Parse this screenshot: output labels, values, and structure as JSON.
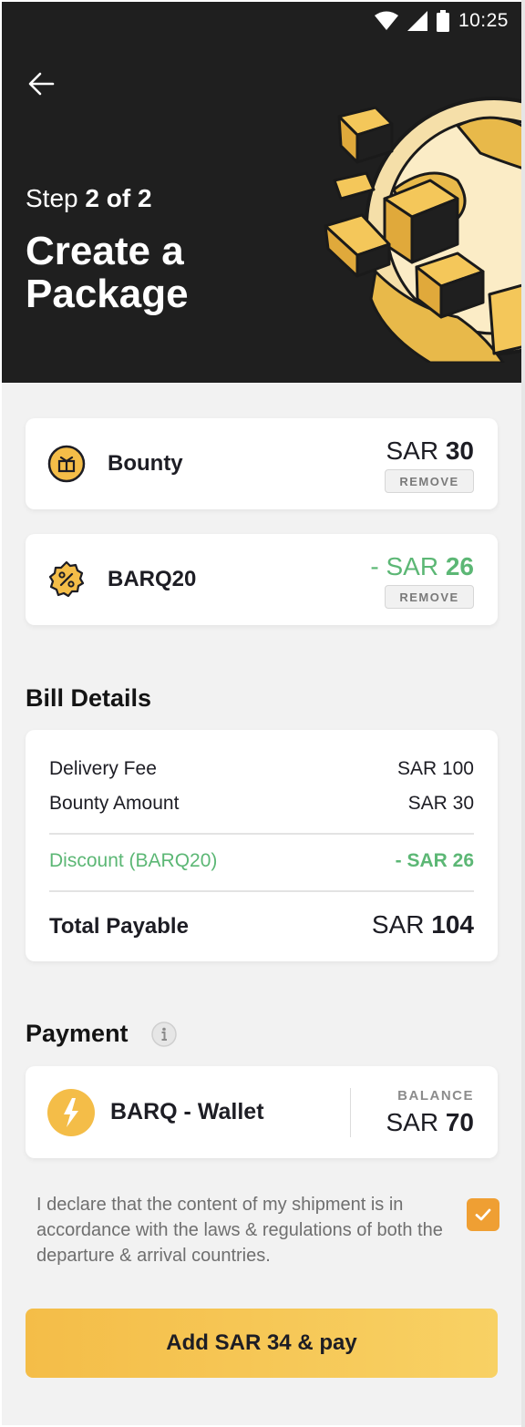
{
  "status_bar": {
    "time": "10:25"
  },
  "header": {
    "step_prefix": "Step",
    "step_value": "2 of 2",
    "title": "Create a Package"
  },
  "items": [
    {
      "label": "Bounty",
      "currency": "SAR",
      "amount": "30",
      "remove_label": "REMOVE",
      "icon": "gift-icon"
    },
    {
      "label": "BARQ20",
      "currency": "- SAR",
      "amount": "26",
      "remove_label": "REMOVE",
      "icon": "discount-badge-icon"
    }
  ],
  "bill": {
    "title": "Bill Details",
    "rows": [
      {
        "label": "Delivery Fee",
        "value": "SAR 100"
      },
      {
        "label": "Bounty Amount",
        "value": "SAR 30"
      }
    ],
    "discount": {
      "label": "Discount (BARQ20)",
      "value": "- SAR 26"
    },
    "total": {
      "label": "Total Payable",
      "currency": "SAR",
      "amount": "104"
    }
  },
  "payment": {
    "title": "Payment",
    "wallet_name": "BARQ - Wallet",
    "balance_label": "BALANCE",
    "balance_currency": "SAR",
    "balance_amount": "70"
  },
  "declaration": {
    "text": "I declare that the content of my shipment is in accordance with the laws & regulations of both the departure & arrival countries.",
    "checked": true
  },
  "pay_button": {
    "label": "Add SAR 34 & pay"
  },
  "colors": {
    "header_bg": "#1f1f1f",
    "accent_yellow": "#f4bd48",
    "discount_green": "#5cb775",
    "checkbox_orange": "#ef9f33",
    "page_bg": "#f2f2f2"
  }
}
